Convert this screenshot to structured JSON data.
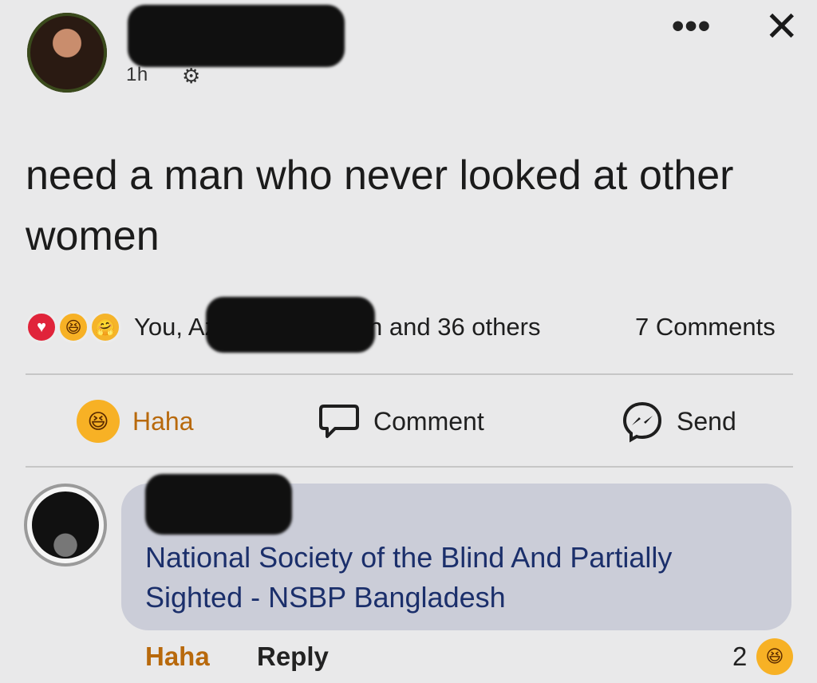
{
  "post": {
    "time": "1h",
    "privacy_icon": "gear-icon",
    "text": "need a man who never looked at other women",
    "more_icon": "•••",
    "close_icon": "✕"
  },
  "reactions": {
    "icons": [
      "heart-love-icon",
      "haha-laugh-icon",
      "care-hug-icon"
    ],
    "prefix": "You, Az",
    "suffix": "n and 36 others",
    "comments_count": "7 Comments"
  },
  "actions": {
    "haha": "Haha",
    "comment": "Comment",
    "send": "Send"
  },
  "comment": {
    "text": "National Society of the Blind And Partially Sighted - NSBP Bangladesh",
    "haha": "Haha",
    "reply": "Reply",
    "reaction_count": "2"
  },
  "colors": {
    "background": "#e9e9ea",
    "haha_accent": "#b8690c",
    "link_blue": "#1b2f6b",
    "bubble": "#cbcdd8"
  }
}
